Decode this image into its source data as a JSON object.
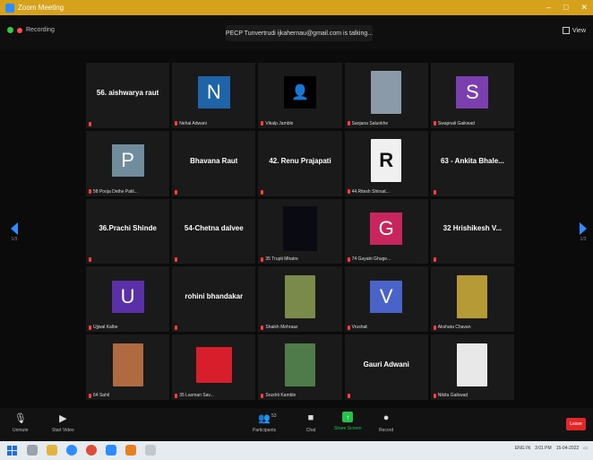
{
  "window": {
    "title": "Zoom Meeting",
    "controls": [
      "–",
      "□",
      "✕"
    ]
  },
  "status": {
    "recording_label": "Recording"
  },
  "meeting_title": "PECP Tunvertrudi ijkahernau@gmail.com is talking...",
  "view_button": "View",
  "tiles": [
    {
      "type": "name",
      "display": "56. aishwarya raut",
      "label": ""
    },
    {
      "type": "avatar",
      "letter": "N",
      "color": "#1f64a8",
      "label": "Nehal Adwani"
    },
    {
      "type": "icon",
      "label": "Vikalp Jamble"
    },
    {
      "type": "photo",
      "color": "#8a9aa8",
      "label": "Sanjana Salunkhe"
    },
    {
      "type": "avatar",
      "letter": "S",
      "color": "#7b3fb0",
      "label": "Swapnali Gaikwad"
    },
    {
      "type": "avatar",
      "letter": "P",
      "color": "#6f8d9c",
      "label": "58 Pooja Dethe Patil..."
    },
    {
      "type": "name",
      "display": "Bhavana Raut",
      "label": ""
    },
    {
      "type": "name",
      "display": "42. Renu Prajapati",
      "label": ""
    },
    {
      "type": "logo",
      "color": "#f0f0f0",
      "label": "44.Ritesh Shirsat..."
    },
    {
      "type": "name",
      "display": "63 - Ankita Bhale...",
      "label": ""
    },
    {
      "type": "name",
      "display": "36.Prachi Shinde",
      "label": ""
    },
    {
      "type": "name",
      "display": "54-Chetna dalvee",
      "label": ""
    },
    {
      "type": "dark",
      "color": "#0a0a12",
      "label": "35 Trupti Mhatre"
    },
    {
      "type": "avatar",
      "letter": "G",
      "color": "#c8245e",
      "label": "74 Gayatri Ghuge..."
    },
    {
      "type": "name",
      "display": "32 Hrishikesh V...",
      "label": ""
    },
    {
      "type": "avatar",
      "letter": "U",
      "color": "#5a2fa8",
      "label": "Ujjwal Kalbe"
    },
    {
      "type": "name",
      "display": "rohini bhandakar",
      "label": ""
    },
    {
      "type": "photo",
      "color": "#7a8a4a",
      "label": "Shaikh Mehraaz"
    },
    {
      "type": "avatar",
      "letter": "V",
      "color": "#4a63c8",
      "label": "Vrushali"
    },
    {
      "type": "photo",
      "color": "#b59a36",
      "label": "Akshata Chavan"
    },
    {
      "type": "photo",
      "color": "#b06a42",
      "label": "64 Sahil"
    },
    {
      "type": "solid",
      "color": "#d81e2b",
      "label": "35 Laxman Sav..."
    },
    {
      "type": "photo",
      "color": "#4f7b4a",
      "label": "Srushti Kamble"
    },
    {
      "type": "name",
      "display": "Gauri Adwani",
      "label": ""
    },
    {
      "type": "photo",
      "color": "#e8e8e8",
      "label": "Nikita Gaikwad"
    }
  ],
  "page_left": "1/3",
  "page_right": "1/3",
  "toolbar": {
    "mute": "Unmute",
    "video": "Start Video",
    "participants": "Participants",
    "participants_count": "53",
    "chat": "Chat",
    "share": "Share Screen",
    "record": "Record",
    "end": "Leave"
  },
  "taskbar": {
    "time": "3:01 PM",
    "date": "15-04-2022",
    "lang": "ENG IN"
  }
}
